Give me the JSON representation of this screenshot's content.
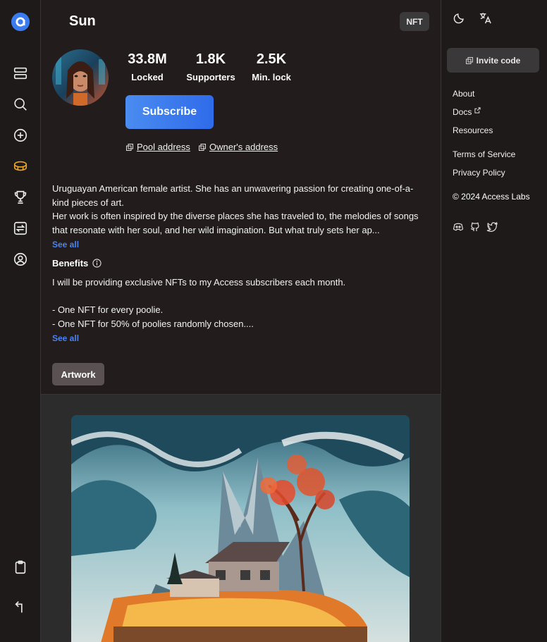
{
  "rail": {
    "icons": [
      "logo-icon",
      "feed-icon",
      "search-icon",
      "create-icon",
      "coins-icon",
      "trophy-icon",
      "swap-icon",
      "profile-icon",
      "clipboard-icon",
      "back-icon"
    ]
  },
  "header": {
    "title": "Sun",
    "badge": "NFT"
  },
  "stats": [
    {
      "value": "33.8M",
      "label": "Locked"
    },
    {
      "value": "1.8K",
      "label": "Supporters"
    },
    {
      "value": "2.5K",
      "label": "Min. lock"
    }
  ],
  "subscribe_label": "Subscribe",
  "addresses": {
    "pool": "Pool address",
    "owner": "Owner's address"
  },
  "description": {
    "line1": "Uruguayan American female artist. She has an unwavering passion for creating one-of-a-kind pieces of art.",
    "line2": "Her work is often inspired by the diverse places she has traveled to, the melodies of songs that resonate with her soul, and her wild imagination. But what truly sets her ap...",
    "see_all": "See all"
  },
  "benefits": {
    "heading": "Benefits",
    "line1": "I will be providing exclusive NFTs to my Access subscribers each month.",
    "line2": "- One NFT for every poolie.",
    "line3": "- One NFT for 50% of poolies randomly chosen....",
    "see_all": "See all"
  },
  "tabs": {
    "artwork": "Artwork"
  },
  "right": {
    "invite_label": "Invite code",
    "links": {
      "about": "About",
      "docs": "Docs",
      "resources": "Resources",
      "terms": "Terms of Service",
      "privacy": "Privacy Policy"
    },
    "copyright": "© 2024 Access Labs",
    "social": [
      "discord-icon",
      "github-icon",
      "twitter-icon"
    ]
  },
  "colors": {
    "accent": "#3b7bf0",
    "coins": "#e8a32a",
    "background": "#1f1a1a"
  }
}
